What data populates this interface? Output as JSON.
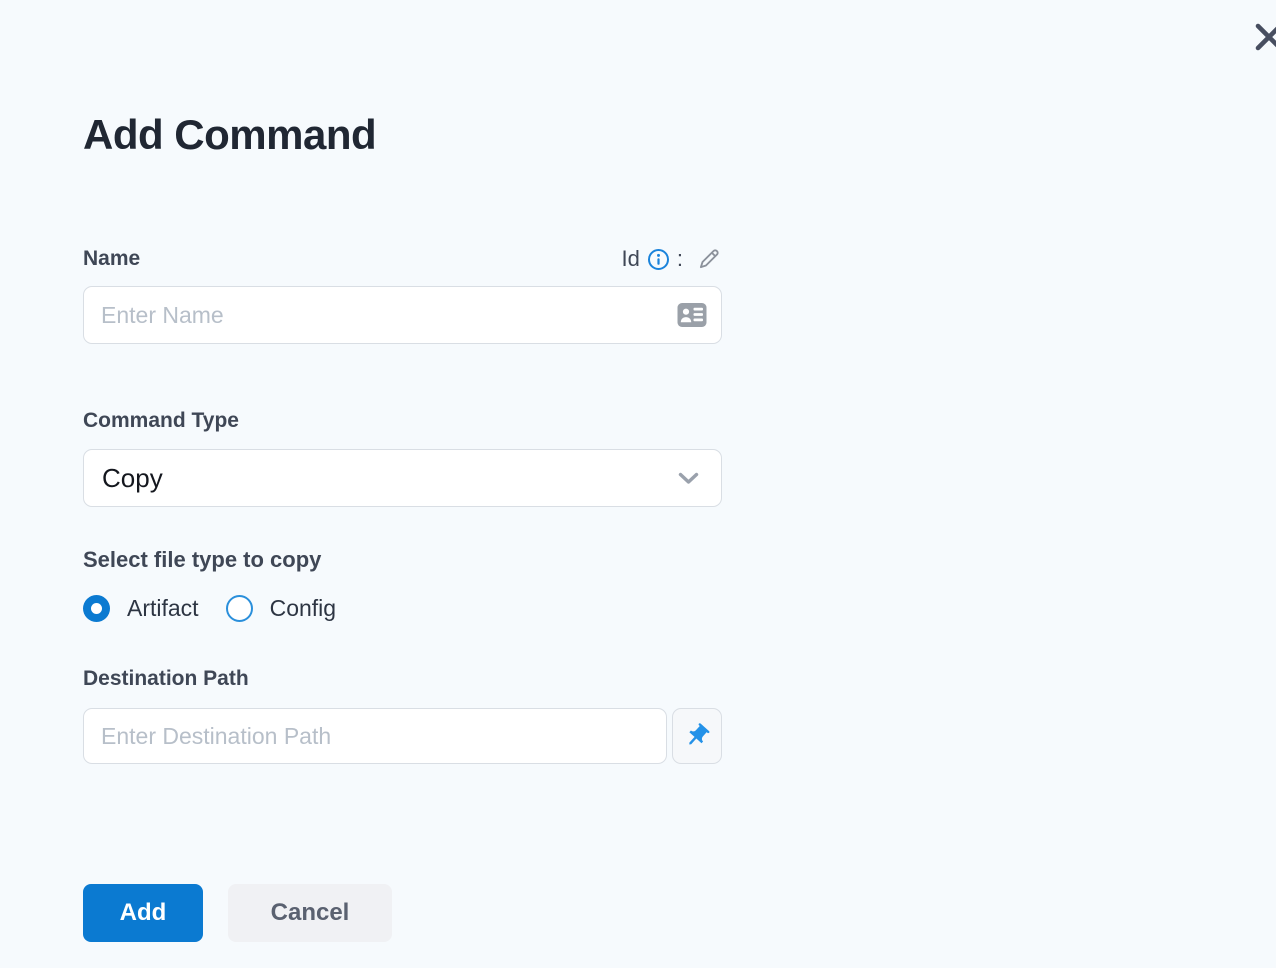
{
  "dialog": {
    "title": "Add Command"
  },
  "name_field": {
    "label": "Name",
    "id_label": "Id",
    "separator": ":",
    "placeholder": "Enter Name"
  },
  "command_type": {
    "label": "Command Type",
    "selected_option": "Copy"
  },
  "file_type": {
    "label": "Select file type to copy",
    "options": [
      {
        "label": "Artifact",
        "selected": true
      },
      {
        "label": "Config",
        "selected": false
      }
    ]
  },
  "destination": {
    "label": "Destination Path",
    "placeholder": "Enter Destination Path"
  },
  "actions": {
    "add_label": "Add",
    "cancel_label": "Cancel"
  },
  "icons": {
    "close": "x-icon",
    "info": "info-circle-icon",
    "edit": "pencil-icon",
    "name_input": "id-card-icon",
    "select": "chevron-down-icon",
    "destination": "pushpin-icon"
  },
  "colors": {
    "background": "#f6fafd",
    "primary_blue": "#0b7ad1",
    "info_blue": "#1a83db",
    "pin_blue": "#2492e8",
    "radio_outline_blue": "#2a8fdb",
    "title_text": "#202733",
    "label_text": "#3f4756",
    "placeholder_text": "#b7bfc9",
    "border": "#d9dee4",
    "cancel_bg": "#f0f1f4",
    "cancel_text": "#5a6170"
  }
}
